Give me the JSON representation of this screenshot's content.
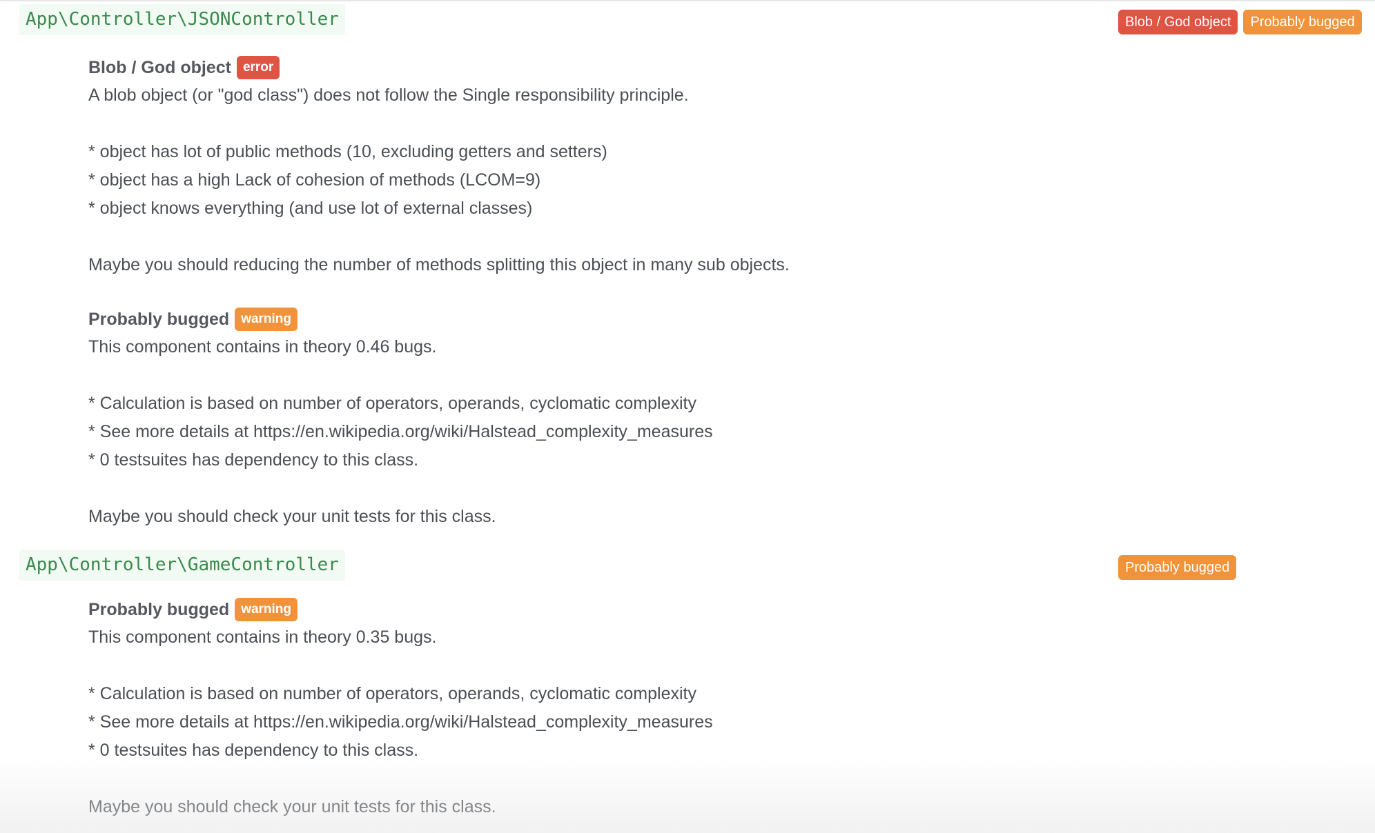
{
  "classes": [
    {
      "name": "App\\Controller\\JSONController",
      "tags": [
        {
          "label": "Blob / God object",
          "level": "error"
        },
        {
          "label": "Probably bugged",
          "level": "warning"
        }
      ],
      "issues": [
        {
          "title": "Blob / God object",
          "level": "error",
          "lines": [
            "A blob object (or \"god class\") does not follow the Single responsibility principle.",
            "",
            "* object has lot of public methods (10, excluding getters and setters)",
            "* object has a high Lack of cohesion of methods (LCOM=9)",
            "* object knows everything (and use lot of external classes)",
            "",
            "Maybe you should reducing the number of methods splitting this object in many sub objects."
          ]
        },
        {
          "title": "Probably bugged",
          "level": "warning",
          "lines": [
            "This component contains in theory 0.46 bugs.",
            "",
            "* Calculation is based on number of operators, operands, cyclomatic complexity",
            "* See more details at https://en.wikipedia.org/wiki/Halstead_complexity_measures",
            "* 0 testsuites has dependency to this class.",
            "",
            "Maybe you should check your unit tests for this class."
          ]
        }
      ]
    },
    {
      "name": "App\\Controller\\GameController",
      "tags": [
        {
          "label": "Probably bugged",
          "level": "warning"
        }
      ],
      "issues": [
        {
          "title": "Probably bugged",
          "level": "warning",
          "lines": [
            "This component contains in theory 0.35 bugs.",
            "",
            "* Calculation is based on number of operators, operands, cyclomatic complexity",
            "* See more details at https://en.wikipedia.org/wiki/Halstead_complexity_measures",
            "* 0 testsuites has dependency to this class.",
            "",
            "Maybe you should check your unit tests for this class."
          ]
        }
      ]
    }
  ]
}
